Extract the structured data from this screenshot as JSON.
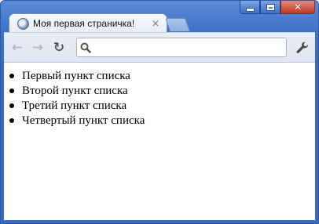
{
  "tab": {
    "title": "Моя первая страничка!",
    "close_glyph": "×"
  },
  "window_controls": {
    "close_glyph": "✕"
  },
  "toolbar": {
    "back_glyph": "←",
    "forward_glyph": "→",
    "reload_glyph": "↻"
  },
  "omnibox": {
    "value": "",
    "icon": "search-icon"
  },
  "content": {
    "items": [
      "Первый пункт списка",
      "Второй пункт списка",
      "Третий пункт списка",
      "Четвертый пункт списка"
    ]
  }
}
